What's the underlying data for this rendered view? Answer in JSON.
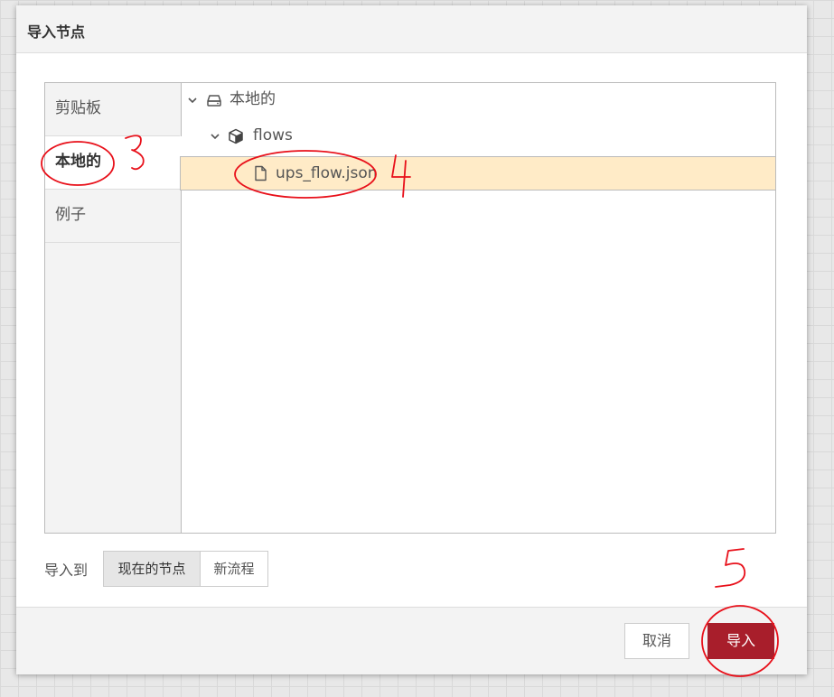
{
  "dialog": {
    "title": "导入节点",
    "tabs": [
      {
        "label": "剪贴板",
        "active": false
      },
      {
        "label": "本地的",
        "active": true
      },
      {
        "label": "例子",
        "active": false
      }
    ],
    "tree": {
      "root_label": "本地的",
      "folder_label": "flows",
      "file_label": "ups_flow.json",
      "selected": "ups_flow.json"
    },
    "import_to": {
      "label": "导入到",
      "options": [
        "现在的节点",
        "新流程"
      ],
      "selected": "现在的节点"
    },
    "buttons": {
      "cancel": "取消",
      "import": "导入"
    }
  },
  "colors": {
    "accent": "#a81e2b",
    "selection": "#ffebc7",
    "annotation": "#e8101a"
  },
  "icons": {
    "root": "drive-icon",
    "folder": "cube-icon",
    "file": "file-icon",
    "expand": "chevron-down-icon"
  }
}
